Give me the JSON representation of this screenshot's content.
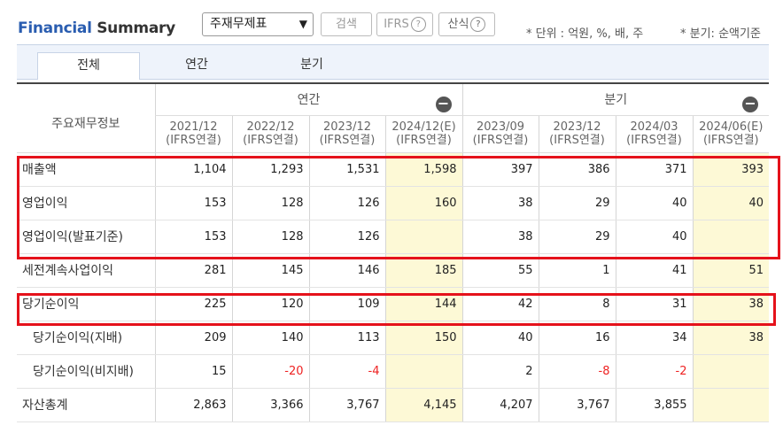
{
  "header": {
    "title_part1": "Financial",
    "title_part2": " Summary",
    "statement_select": "주재무제표",
    "search_button": "검색",
    "ifrs_button": "IFRS",
    "calc_button": "산식",
    "help_glyph": "?",
    "unit_note": "* 단위 : 억원, %, 배, 주",
    "quarter_note": "* 분기: 순액기준"
  },
  "tabs": [
    "전체",
    "연간",
    "분기"
  ],
  "table": {
    "row_header": "주요재무정보",
    "group_annual": "연간",
    "group_quarter": "분기",
    "collapse_glyph": "−",
    "columns": [
      {
        "period": "2021/12",
        "basis": "(IFRS연결)"
      },
      {
        "period": "2022/12",
        "basis": "(IFRS연결)"
      },
      {
        "period": "2023/12",
        "basis": "(IFRS연결)"
      },
      {
        "period": "2024/12(E)",
        "basis": "(IFRS연결)"
      },
      {
        "period": "2023/09",
        "basis": "(IFRS연결)"
      },
      {
        "period": "2023/12",
        "basis": "(IFRS연결)"
      },
      {
        "period": "2024/03",
        "basis": "(IFRS연결)"
      },
      {
        "period": "2024/06(E)",
        "basis": "(IFRS연결)"
      }
    ],
    "rows": [
      {
        "label": "매출액",
        "values": [
          "1,104",
          "1,293",
          "1,531",
          "1,598",
          "397",
          "386",
          "371",
          "393"
        ]
      },
      {
        "label": "영업이익",
        "values": [
          "153",
          "128",
          "126",
          "160",
          "38",
          "29",
          "40",
          "40"
        ]
      },
      {
        "label": "영업이익(발표기준)",
        "values": [
          "153",
          "128",
          "126",
          "",
          "38",
          "29",
          "40",
          ""
        ]
      },
      {
        "label": "세전계속사업이익",
        "values": [
          "281",
          "145",
          "146",
          "185",
          "55",
          "1",
          "41",
          "51"
        ]
      },
      {
        "label": "당기순이익",
        "values": [
          "225",
          "120",
          "109",
          "144",
          "42",
          "8",
          "31",
          "38"
        ]
      },
      {
        "label": "당기순이익(지배)",
        "values": [
          "209",
          "140",
          "113",
          "150",
          "40",
          "16",
          "34",
          "38"
        ]
      },
      {
        "label": "당기순이익(비지배)",
        "values": [
          "15",
          "-20",
          "-4",
          "",
          "2",
          "-8",
          "-2",
          ""
        ]
      },
      {
        "label": "자산총계",
        "values": [
          "2,863",
          "3,366",
          "3,767",
          "4,145",
          "4,207",
          "3,767",
          "3,855",
          ""
        ]
      }
    ]
  },
  "colors": {
    "accent_blue": "#2a5db0",
    "estimate_bg": "#fdf9d6",
    "negative": "#e22222",
    "highlight_box": "#e5121b"
  }
}
